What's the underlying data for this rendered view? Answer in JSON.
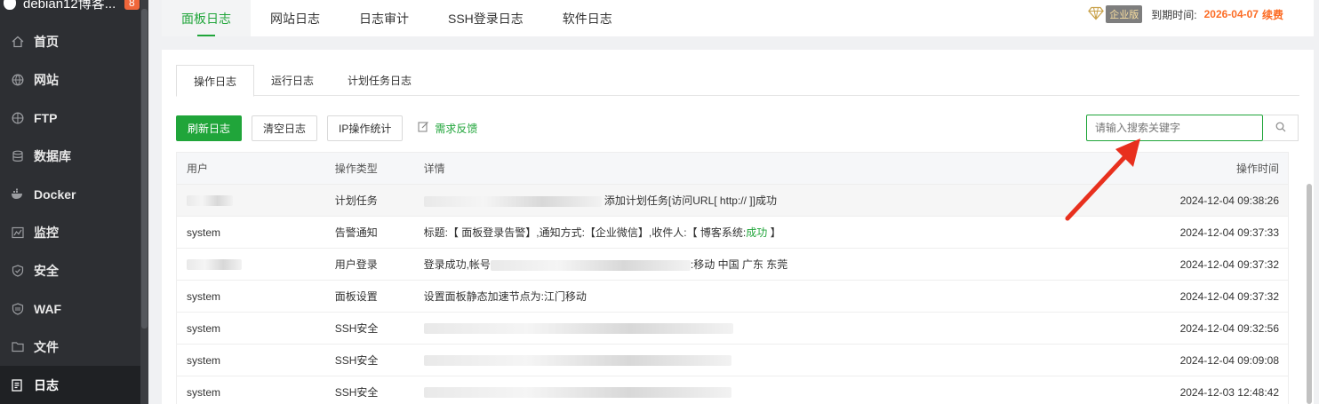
{
  "sidebar": {
    "brand_name": "debian12博客...",
    "brand_badge": "8",
    "items": [
      {
        "label": "首页",
        "icon": "home-icon"
      },
      {
        "label": "网站",
        "icon": "globe-icon"
      },
      {
        "label": "FTP",
        "icon": "globe-icon"
      },
      {
        "label": "数据库",
        "icon": "database-icon"
      },
      {
        "label": "Docker",
        "icon": "docker-icon"
      },
      {
        "label": "监控",
        "icon": "monitor-icon"
      },
      {
        "label": "安全",
        "icon": "shield-icon"
      },
      {
        "label": "WAF",
        "icon": "shield-icon"
      },
      {
        "label": "文件",
        "icon": "folder-icon"
      },
      {
        "label": "日志",
        "icon": "log-icon"
      }
    ]
  },
  "top_tabs": [
    "面板日志",
    "网站日志",
    "日志审计",
    "SSH登录日志",
    "软件日志"
  ],
  "expire": {
    "edition": "企业版",
    "label": "到期时间:",
    "date": "2026-04-07",
    "renew": "续费"
  },
  "sub_tabs": [
    "操作日志",
    "运行日志",
    "计划任务日志"
  ],
  "toolbar": {
    "refresh": "刷新日志",
    "clear": "清空日志",
    "ip_stats": "IP操作统计",
    "feedback": "需求反馈"
  },
  "search": {
    "placeholder": "请输入搜索关键字"
  },
  "table": {
    "headers": {
      "user": "用户",
      "type": "操作类型",
      "detail": "详情",
      "time": "操作时间"
    },
    "rows": [
      {
        "user": "",
        "type": "计划任务",
        "detail_suffix": "添加计划任务[访问URL[ http:// ]]成功",
        "time": "2024-12-04 09:38:26"
      },
      {
        "user": "system",
        "type": "告警通知",
        "detail_prefix": "标题:【 面板登录告警】,通知方式:【企业微信】,收件人:【 博客系统:",
        "detail_ok": "成功",
        "detail_suffix": " 】",
        "time": "2024-12-04 09:37:33"
      },
      {
        "user": "",
        "type": "用户登录",
        "detail_prefix": "登录成功,帐号",
        "detail_suffix": ":移动 中国 广东 东莞",
        "time": "2024-12-04 09:37:32"
      },
      {
        "user": "system",
        "type": "面板设置",
        "detail_prefix": "设置面板静态加速节点为:江门移动",
        "time": "2024-12-04 09:37:32"
      },
      {
        "user": "system",
        "type": "SSH安全",
        "time": "2024-12-04 09:32:56"
      },
      {
        "user": "system",
        "type": "SSH安全",
        "time": "2024-12-04 09:09:08"
      },
      {
        "user": "system",
        "type": "SSH安全",
        "time": "2024-12-03 12:48:42"
      }
    ]
  },
  "colors": {
    "accent": "#20a53a",
    "warning": "#fc6d26",
    "sidebar_bg": "#2d2f33",
    "arrow": "#e8301e"
  }
}
